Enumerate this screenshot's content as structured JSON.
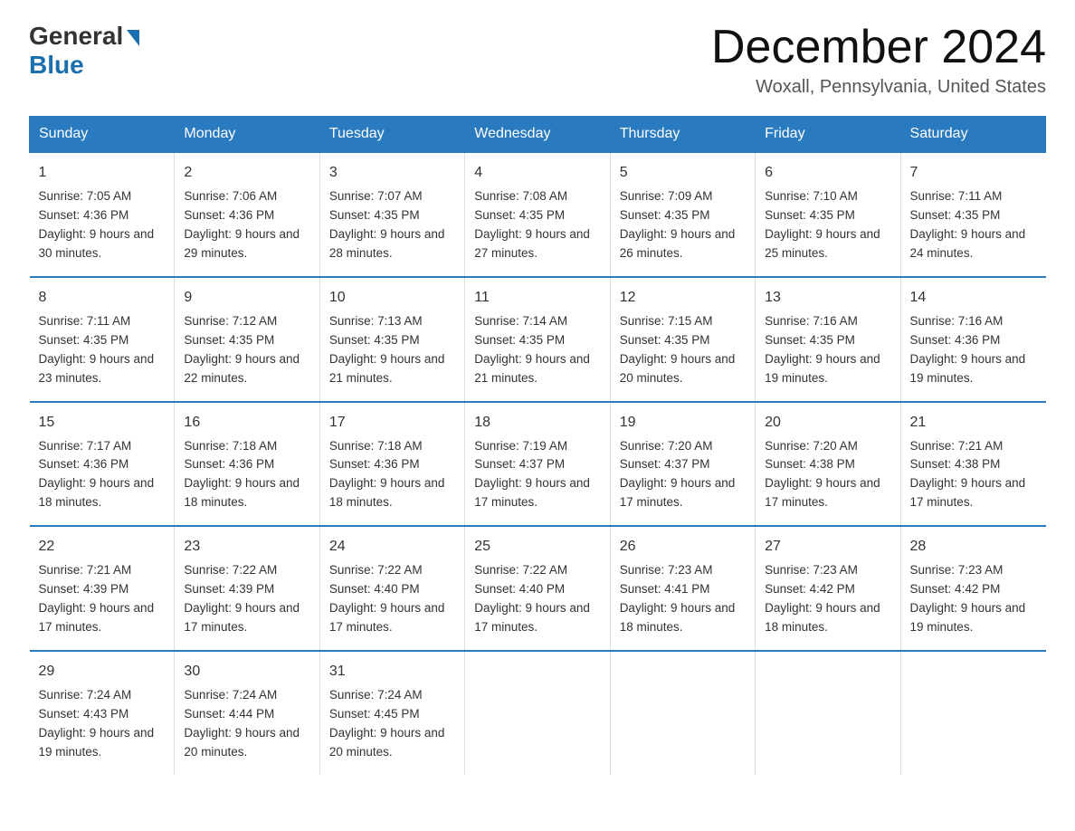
{
  "logo": {
    "general": "General",
    "blue": "Blue"
  },
  "header": {
    "month_year": "December 2024",
    "location": "Woxall, Pennsylvania, United States"
  },
  "days_of_week": [
    "Sunday",
    "Monday",
    "Tuesday",
    "Wednesday",
    "Thursday",
    "Friday",
    "Saturday"
  ],
  "weeks": [
    [
      {
        "day": "1",
        "sunrise": "7:05 AM",
        "sunset": "4:36 PM",
        "daylight": "9 hours and 30 minutes."
      },
      {
        "day": "2",
        "sunrise": "7:06 AM",
        "sunset": "4:36 PM",
        "daylight": "9 hours and 29 minutes."
      },
      {
        "day": "3",
        "sunrise": "7:07 AM",
        "sunset": "4:35 PM",
        "daylight": "9 hours and 28 minutes."
      },
      {
        "day": "4",
        "sunrise": "7:08 AM",
        "sunset": "4:35 PM",
        "daylight": "9 hours and 27 minutes."
      },
      {
        "day": "5",
        "sunrise": "7:09 AM",
        "sunset": "4:35 PM",
        "daylight": "9 hours and 26 minutes."
      },
      {
        "day": "6",
        "sunrise": "7:10 AM",
        "sunset": "4:35 PM",
        "daylight": "9 hours and 25 minutes."
      },
      {
        "day": "7",
        "sunrise": "7:11 AM",
        "sunset": "4:35 PM",
        "daylight": "9 hours and 24 minutes."
      }
    ],
    [
      {
        "day": "8",
        "sunrise": "7:11 AM",
        "sunset": "4:35 PM",
        "daylight": "9 hours and 23 minutes."
      },
      {
        "day": "9",
        "sunrise": "7:12 AM",
        "sunset": "4:35 PM",
        "daylight": "9 hours and 22 minutes."
      },
      {
        "day": "10",
        "sunrise": "7:13 AM",
        "sunset": "4:35 PM",
        "daylight": "9 hours and 21 minutes."
      },
      {
        "day": "11",
        "sunrise": "7:14 AM",
        "sunset": "4:35 PM",
        "daylight": "9 hours and 21 minutes."
      },
      {
        "day": "12",
        "sunrise": "7:15 AM",
        "sunset": "4:35 PM",
        "daylight": "9 hours and 20 minutes."
      },
      {
        "day": "13",
        "sunrise": "7:16 AM",
        "sunset": "4:35 PM",
        "daylight": "9 hours and 19 minutes."
      },
      {
        "day": "14",
        "sunrise": "7:16 AM",
        "sunset": "4:36 PM",
        "daylight": "9 hours and 19 minutes."
      }
    ],
    [
      {
        "day": "15",
        "sunrise": "7:17 AM",
        "sunset": "4:36 PM",
        "daylight": "9 hours and 18 minutes."
      },
      {
        "day": "16",
        "sunrise": "7:18 AM",
        "sunset": "4:36 PM",
        "daylight": "9 hours and 18 minutes."
      },
      {
        "day": "17",
        "sunrise": "7:18 AM",
        "sunset": "4:36 PM",
        "daylight": "9 hours and 18 minutes."
      },
      {
        "day": "18",
        "sunrise": "7:19 AM",
        "sunset": "4:37 PM",
        "daylight": "9 hours and 17 minutes."
      },
      {
        "day": "19",
        "sunrise": "7:20 AM",
        "sunset": "4:37 PM",
        "daylight": "9 hours and 17 minutes."
      },
      {
        "day": "20",
        "sunrise": "7:20 AM",
        "sunset": "4:38 PM",
        "daylight": "9 hours and 17 minutes."
      },
      {
        "day": "21",
        "sunrise": "7:21 AM",
        "sunset": "4:38 PM",
        "daylight": "9 hours and 17 minutes."
      }
    ],
    [
      {
        "day": "22",
        "sunrise": "7:21 AM",
        "sunset": "4:39 PM",
        "daylight": "9 hours and 17 minutes."
      },
      {
        "day": "23",
        "sunrise": "7:22 AM",
        "sunset": "4:39 PM",
        "daylight": "9 hours and 17 minutes."
      },
      {
        "day": "24",
        "sunrise": "7:22 AM",
        "sunset": "4:40 PM",
        "daylight": "9 hours and 17 minutes."
      },
      {
        "day": "25",
        "sunrise": "7:22 AM",
        "sunset": "4:40 PM",
        "daylight": "9 hours and 17 minutes."
      },
      {
        "day": "26",
        "sunrise": "7:23 AM",
        "sunset": "4:41 PM",
        "daylight": "9 hours and 18 minutes."
      },
      {
        "day": "27",
        "sunrise": "7:23 AM",
        "sunset": "4:42 PM",
        "daylight": "9 hours and 18 minutes."
      },
      {
        "day": "28",
        "sunrise": "7:23 AM",
        "sunset": "4:42 PM",
        "daylight": "9 hours and 19 minutes."
      }
    ],
    [
      {
        "day": "29",
        "sunrise": "7:24 AM",
        "sunset": "4:43 PM",
        "daylight": "9 hours and 19 minutes."
      },
      {
        "day": "30",
        "sunrise": "7:24 AM",
        "sunset": "4:44 PM",
        "daylight": "9 hours and 20 minutes."
      },
      {
        "day": "31",
        "sunrise": "7:24 AM",
        "sunset": "4:45 PM",
        "daylight": "9 hours and 20 minutes."
      },
      null,
      null,
      null,
      null
    ]
  ]
}
